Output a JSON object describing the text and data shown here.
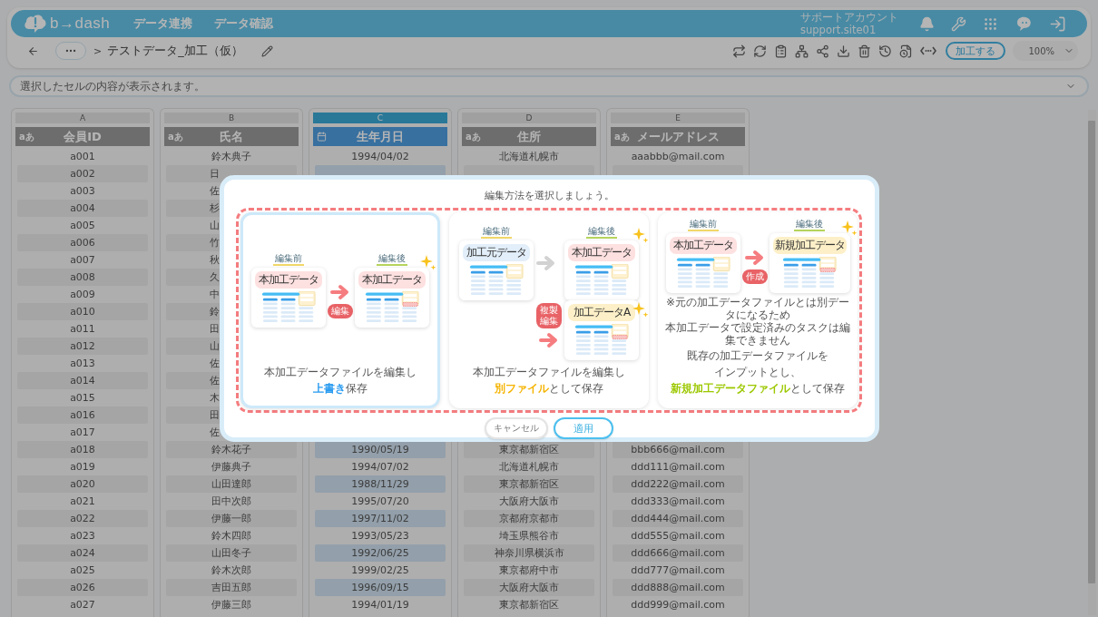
{
  "header": {
    "logo": "b→dash",
    "nav": [
      "データ連携",
      "データ確認"
    ],
    "account": {
      "name": "サポートアカウント",
      "id": "support.site01"
    }
  },
  "toolbar": {
    "separator": ">",
    "file_name": "テストデータ_加工（仮）",
    "process_button": "加工する",
    "zoom": "100%"
  },
  "formula_bar": {
    "placeholder": "選択したセルの内容が表示されます。"
  },
  "table": {
    "columns": [
      {
        "letter": "A",
        "name": "会員ID",
        "kind": "text",
        "type_label": "aあ",
        "selected": false
      },
      {
        "letter": "B",
        "name": "氏名",
        "kind": "text",
        "type_label": "aあ",
        "selected": false
      },
      {
        "letter": "C",
        "name": "生年月日",
        "kind": "date",
        "selected": true
      },
      {
        "letter": "D",
        "name": "住所",
        "kind": "text",
        "type_label": "aあ",
        "selected": false
      },
      {
        "letter": "E",
        "name": "メールアドレス",
        "kind": "text",
        "type_label": "aあ",
        "selected": false
      }
    ],
    "rows": [
      {
        "cells": [
          "a001",
          "鈴木典子",
          "1994/04/02",
          "北海道札幌市",
          "aaabbb@mail.com"
        ]
      },
      {
        "cells": [
          "a002",
          "日"
        ]
      },
      {
        "cells": [
          "a003",
          "佐"
        ]
      },
      {
        "cells": [
          "a004",
          "杉"
        ]
      },
      {
        "cells": [
          "a005",
          "山"
        ]
      },
      {
        "cells": [
          "a006",
          "竹"
        ]
      },
      {
        "cells": [
          "a007",
          "秋"
        ]
      },
      {
        "cells": [
          "a008",
          "久"
        ]
      },
      {
        "cells": [
          "a009",
          "中"
        ]
      },
      {
        "cells": [
          "a010",
          "鈴"
        ]
      },
      {
        "cells": [
          "a011",
          "田"
        ]
      },
      {
        "cells": [
          "a012",
          "山"
        ]
      },
      {
        "cells": [
          "a013",
          "佐"
        ]
      },
      {
        "cells": [
          "a014",
          "佐"
        ]
      },
      {
        "cells": [
          "a015",
          "木"
        ]
      },
      {
        "cells": [
          "a016",
          "田"
        ]
      },
      {
        "cells": [
          "a017",
          "佐"
        ]
      },
      {
        "cells": [
          "a018",
          "鈴木花子",
          "1990/05/19",
          "東京都新宿区",
          "bbb666@mail.com"
        ]
      },
      {
        "cells": [
          "a019",
          "伊藤典子",
          "1994/07/02",
          "北海道札幌市",
          "ddd111@mail.com"
        ]
      },
      {
        "cells": [
          "a020",
          "山田達郎",
          "1988/11/29",
          "東京都新宿区",
          "ddd222@mail.com"
        ]
      },
      {
        "cells": [
          "a021",
          "田中次郎",
          "1995/07/20",
          "大阪府大阪市",
          "ddd333@mail.com"
        ]
      },
      {
        "cells": [
          "a022",
          "伊藤一郎",
          "1997/11/02",
          "京都府京都市",
          "ddd444@mail.com"
        ]
      },
      {
        "cells": [
          "a023",
          "鈴木四郎",
          "1993/05/23",
          "埼玉県熊谷市",
          "ddd555@mail.com"
        ]
      },
      {
        "cells": [
          "a024",
          "山田冬子",
          "1992/06/25",
          "神奈川県横浜市",
          "ddd666@mail.com"
        ]
      },
      {
        "cells": [
          "a025",
          "鈴木次郎",
          "1999/02/25",
          "東京都府中市",
          "ddd777@mail.com"
        ]
      },
      {
        "cells": [
          "a026",
          "吉田五郎",
          "1996/09/15",
          "大阪府大阪市",
          "ddd888@mail.com"
        ]
      },
      {
        "cells": [
          "a027",
          "伊藤三郎",
          "1994/01/19",
          "東京都新宿区",
          "ddd999@mail.com"
        ]
      }
    ]
  },
  "dialog": {
    "title": "編集方法を選択しましょう。",
    "options": [
      {
        "kind": "overwrite",
        "selected": true,
        "color": "#2b9cf0",
        "before": {
          "label": "編集前",
          "doc": "本加工データ",
          "color": "#fde0e0",
          "edited": false
        },
        "after": {
          "label": "編集後",
          "doc": "本加工データ",
          "color": "#fde0e0",
          "edited": true
        },
        "action": [
          "編集"
        ],
        "caption": [
          [
            {
              "text": "本加工データファイルを編集し",
              "accent": false
            }
          ],
          [
            {
              "text": "上書き",
              "accent": true
            },
            {
              "text": "保存",
              "accent": false
            }
          ]
        ]
      },
      {
        "kind": "copy",
        "selected": false,
        "color": "#f5b400",
        "before": {
          "label": "編集前",
          "doc": "加工元データ",
          "color": "#e2eef9",
          "edited": false
        },
        "after": {
          "label": "編集後",
          "doc": "本加工データ",
          "color": "#fde0e0",
          "edited": false
        },
        "copy": {
          "doc": "加工データA",
          "color": "#fdf0c8",
          "edited": true
        },
        "action": [
          "複製",
          "編集"
        ],
        "caption": [
          [
            {
              "text": "本加工データファイルを編集し",
              "accent": false
            }
          ],
          [
            {
              "text": "別ファイル",
              "accent": true
            },
            {
              "text": "として保存",
              "accent": false
            }
          ]
        ]
      },
      {
        "kind": "new",
        "selected": false,
        "color": "#9cc800",
        "before": {
          "label": "編集前",
          "doc": "本加工データ",
          "color": "#fde0e0",
          "edited": false
        },
        "after": {
          "label": "編集後",
          "doc": "新規加工データ",
          "color": "#fdf0c8",
          "edited": true
        },
        "action": [
          "作成"
        ],
        "note": [
          "※元の加工データファイルとは別データになるため",
          "本加工データで設定済みのタスクは編集できません"
        ],
        "caption": [
          [
            {
              "text": "既存の加工データファイルを",
              "accent": false
            }
          ],
          [
            {
              "text": "インプットとし、",
              "accent": false
            }
          ],
          [
            {
              "text": "新規加工データファイル",
              "accent": true
            },
            {
              "text": "として保存",
              "accent": false
            }
          ]
        ]
      }
    ],
    "buttons": [
      {
        "label": "キャンセル",
        "kind": "secondary"
      },
      {
        "label": "適用",
        "kind": "primary"
      }
    ]
  }
}
